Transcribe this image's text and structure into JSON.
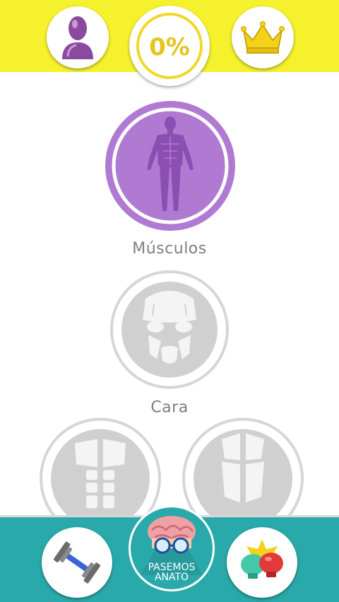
{
  "header": {
    "progress": "0%",
    "profile_icon": "user-silhouette-icon",
    "ranking_icon": "crown-icon",
    "accent": "#f5f12c"
  },
  "categories": [
    {
      "label": "Músculos",
      "state": "active",
      "color": "#b07ad3"
    },
    {
      "label": "Cara",
      "state": "locked",
      "color": "#d0d0d0"
    },
    {
      "label": "",
      "state": "locked",
      "color": "#d0d0d0"
    },
    {
      "label": "",
      "state": "locked",
      "color": "#d0d0d0"
    }
  ],
  "footer": {
    "left_icon": "dumbbell-icon",
    "right_icon": "boxing-gloves-icon",
    "logo_line1": "PASEMOS",
    "logo_line2": "ANATO",
    "accent": "#2aa9ab"
  }
}
